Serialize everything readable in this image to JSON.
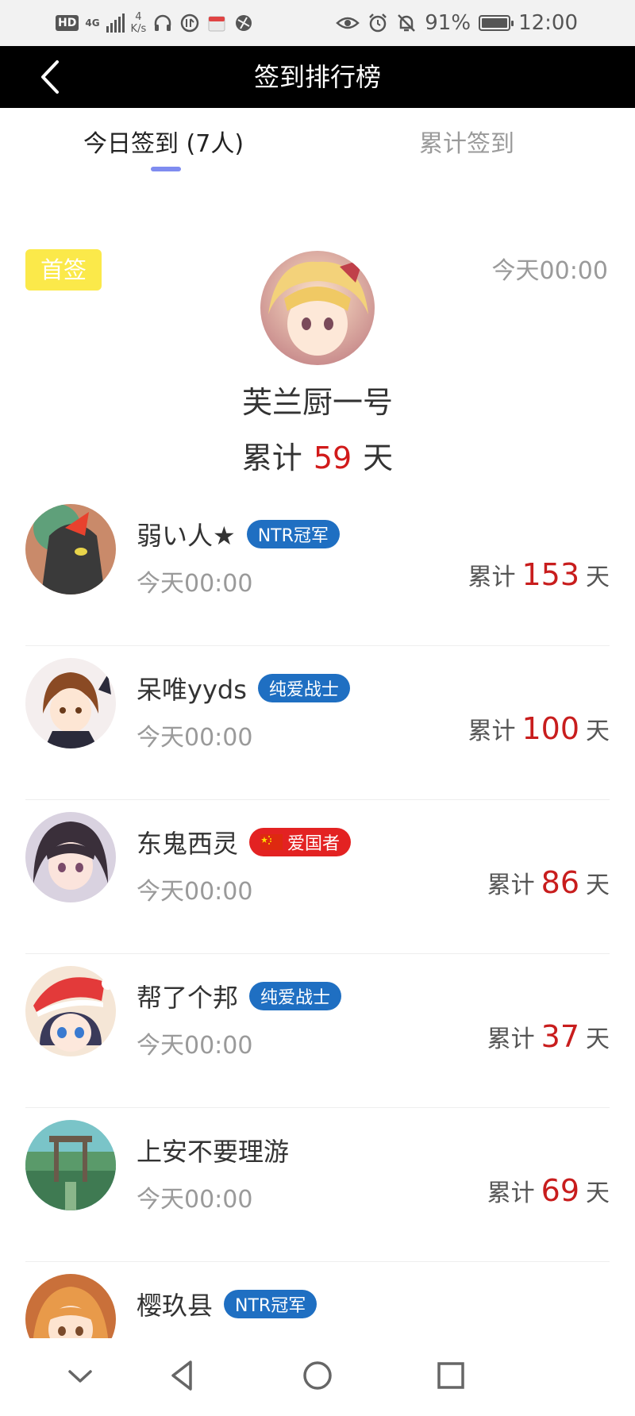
{
  "status_bar": {
    "hd": "HD",
    "network": "4G",
    "speed_value": "4",
    "speed_unit": "K/s",
    "battery": "91%",
    "time": "12:00"
  },
  "header": {
    "title": "签到排行榜"
  },
  "tabs": [
    {
      "label": "今日签到 (7人)",
      "active": true
    },
    {
      "label": "累计签到",
      "active": false
    }
  ],
  "first_sign": {
    "badge": "首签",
    "time": "今天00:00",
    "name": "芙兰厨一号",
    "total_prefix": "累计",
    "total_days": "59",
    "total_suffix": "天"
  },
  "entries": [
    {
      "name": "弱い人★",
      "tag": "NTR冠军",
      "tag_color": "#1f6fc2",
      "time": "今天00:00",
      "total_prefix": "累计",
      "total_days": "153",
      "total_suffix": "天"
    },
    {
      "name": "呆唯yyds",
      "tag": "纯爱战士",
      "tag_color": "#1f6fc2",
      "time": "今天00:00",
      "total_prefix": "累计",
      "total_days": "100",
      "total_suffix": "天"
    },
    {
      "name": "东鬼西灵",
      "tag": "爱国者",
      "tag_color": "#e32222",
      "time": "今天00:00",
      "total_prefix": "累计",
      "total_days": "86",
      "total_suffix": "天"
    },
    {
      "name": "帮了个邦",
      "tag": "纯爱战士",
      "tag_color": "#1f6fc2",
      "time": "今天00:00",
      "total_prefix": "累计",
      "total_days": "37",
      "total_suffix": "天"
    },
    {
      "name": "上安不要理游",
      "tag": "",
      "time": "今天00:00",
      "total_prefix": "累计",
      "total_days": "69",
      "total_suffix": "天"
    },
    {
      "name": "樱玖县",
      "tag": "NTR冠军",
      "tag_color": "#1f6fc2"
    }
  ],
  "colors": {
    "accent_indicator": "#7f8cf0",
    "first_badge": "#fbe94a",
    "day_count": "#c81d1d"
  },
  "nav": {
    "icons": [
      "chevron-down-icon",
      "back-triangle-icon",
      "home-circle-icon",
      "recents-square-icon"
    ]
  }
}
